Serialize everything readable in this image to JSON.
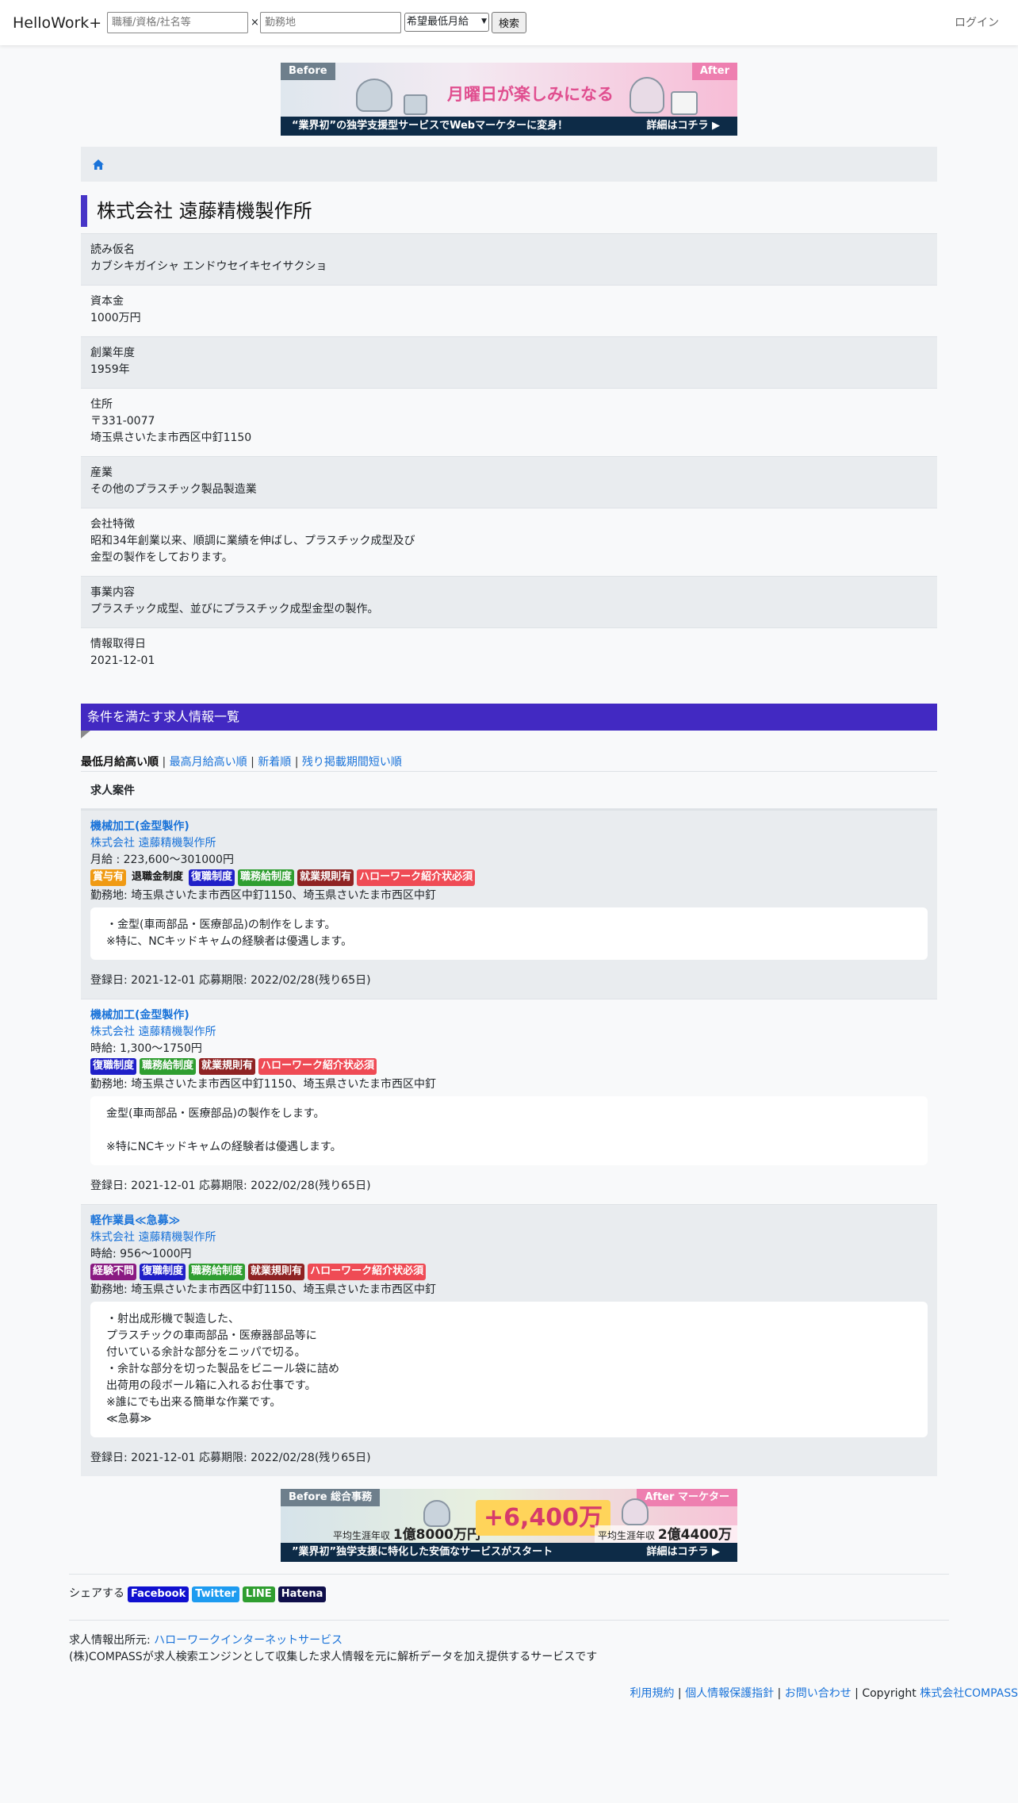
{
  "nav": {
    "brand": "HelloWork+",
    "keyword_placeholder": "職種/資格/社名等",
    "times": "×",
    "location_placeholder": "勤務地",
    "salary_select": "希望最低月給",
    "search_button": "検索",
    "login": "ログイン"
  },
  "banner_top": {
    "before": "Before",
    "after": "After",
    "headline": "月曜日が楽しみになる",
    "footer": "“業界初”の独学支援型サービスでWebマーケターに変身！",
    "more": "詳細はコチラ ▶"
  },
  "company": {
    "title": "株式会社 遠藤精機製作所",
    "fields": [
      {
        "label": "読み仮名",
        "value": "カブシキガイシャ エンドウセイキセイサクショ"
      },
      {
        "label": "資本金",
        "value": "1000万円"
      },
      {
        "label": "創業年度",
        "value": "1959年"
      },
      {
        "label": "住所",
        "value": "〒331-0077\n埼玉県さいたま市西区中釘1150"
      },
      {
        "label": "産業",
        "value": "その他のプラスチック製品製造業"
      },
      {
        "label": "会社特徴",
        "value": "昭和34年創業以来、順調に業績を伸ばし、プラスチック成型及び\n金型の製作をしております。"
      },
      {
        "label": "事業内容",
        "value": "プラスチック成型、並びにプラスチック成型金型の製作。"
      },
      {
        "label": "情報取得日",
        "value": "2021-12-01"
      }
    ]
  },
  "jobs_section": {
    "title": "条件を満たす求人情報一覧",
    "sort": {
      "active": "最低月給高い順",
      "options": [
        "最高月給高い順",
        "新着順",
        "残り掲載期間短い順"
      ]
    },
    "header": "求人案件"
  },
  "jobs": [
    {
      "title": "機械加工(金型製作)",
      "company": "株式会社 遠藤精機製作所",
      "wage": "月給 : 223,600〜301000円",
      "badges": [
        {
          "label": "賞与有",
          "kind": "bonus"
        },
        {
          "label": "退職金制度",
          "kind": "retire"
        },
        {
          "label": "復職制度",
          "kind": "return"
        },
        {
          "label": "職務給制度",
          "kind": "pay"
        },
        {
          "label": "就業規則有",
          "kind": "rules"
        },
        {
          "label": "ハローワーク紹介状必須",
          "kind": "hw"
        }
      ],
      "location": "勤務地: 埼玉県さいたま市西区中釘1150、埼玉県さいたま市西区中釘",
      "description": "・金型(車両部品・医療部品)の制作をします。\n※特に、NCキッドキャムの経験者は優遇します。",
      "dates": "登録日: 2021-12-01 応募期限: 2022/02/28(残り65日)"
    },
    {
      "title": "機械加工(金型製作)",
      "company": "株式会社 遠藤精機製作所",
      "wage": "時給: 1,300〜1750円",
      "badges": [
        {
          "label": "復職制度",
          "kind": "return"
        },
        {
          "label": "職務給制度",
          "kind": "pay"
        },
        {
          "label": "就業規則有",
          "kind": "rules"
        },
        {
          "label": "ハローワーク紹介状必須",
          "kind": "hw"
        }
      ],
      "location": "勤務地: 埼玉県さいたま市西区中釘1150、埼玉県さいたま市西区中釘",
      "description": "金型(車両部品・医療部品)の製作をします。\n\n※特にNCキッドキャムの経験者は優遇します。",
      "dates": "登録日: 2021-12-01 応募期限: 2022/02/28(残り65日)"
    },
    {
      "title": "軽作業員≪急募≫",
      "company": "株式会社 遠藤精機製作所",
      "wage": "時給: 956〜1000円",
      "badges": [
        {
          "label": "経験不問",
          "kind": "exp"
        },
        {
          "label": "復職制度",
          "kind": "return"
        },
        {
          "label": "職務給制度",
          "kind": "pay"
        },
        {
          "label": "就業規則有",
          "kind": "rules"
        },
        {
          "label": "ハローワーク紹介状必須",
          "kind": "hw"
        }
      ],
      "location": "勤務地: 埼玉県さいたま市西区中釘1150、埼玉県さいたま市西区中釘",
      "description": "・射出成形機で製造した、\nプラスチックの車両部品・医療器部品等に\n付いている余計な部分をニッパで切る。\n・余計な部分を切った製品をビニール袋に詰め\n出荷用の段ボール箱に入れるお仕事です。\n※誰にでも出来る簡単な作業です。\n≪急募≫",
      "dates": "登録日: 2021-12-01 応募期限: 2022/02/28(残り65日)"
    }
  ],
  "banner_bottom": {
    "before": "Before 総合事務",
    "after": "After マーケター",
    "stat_before_label": "平均生涯年収",
    "stat_before_value": "1億8000万円",
    "plus": "+6,400万",
    "stat_after_label": "平均生涯年収",
    "stat_after_value": "2億4400万円",
    "footer": "”業界初”独学支援に特化した安価なサービスがスタート",
    "more": "詳細はコチラ ▶"
  },
  "share": {
    "label": "シェアする",
    "buttons": [
      "Facebook",
      "Twitter",
      "LINE",
      "Hatena"
    ]
  },
  "source": {
    "label": "求人情報出所元: ",
    "link": "ハローワークインターネットサービス",
    "note": "(株)COMPASSが求人検索エンジンとして収集した求人情報を元に解析データを加え提供するサービスです"
  },
  "footer": {
    "terms": "利用規約",
    "privacy": "個人情報保護指針",
    "contact": "お問い合わせ",
    "copyright": "Copyright",
    "company": "株式会社COMPASS",
    "sep": " | "
  },
  "colors": {
    "accent": "#4229c2",
    "link": "#1a73d9",
    "badge_bonus": "#f09a13",
    "badge_return": "#2020c8",
    "badge_pay": "#2f9e30",
    "badge_rules": "#8f2323",
    "badge_hw": "#ef4b55",
    "badge_exp": "#8a1a82"
  }
}
